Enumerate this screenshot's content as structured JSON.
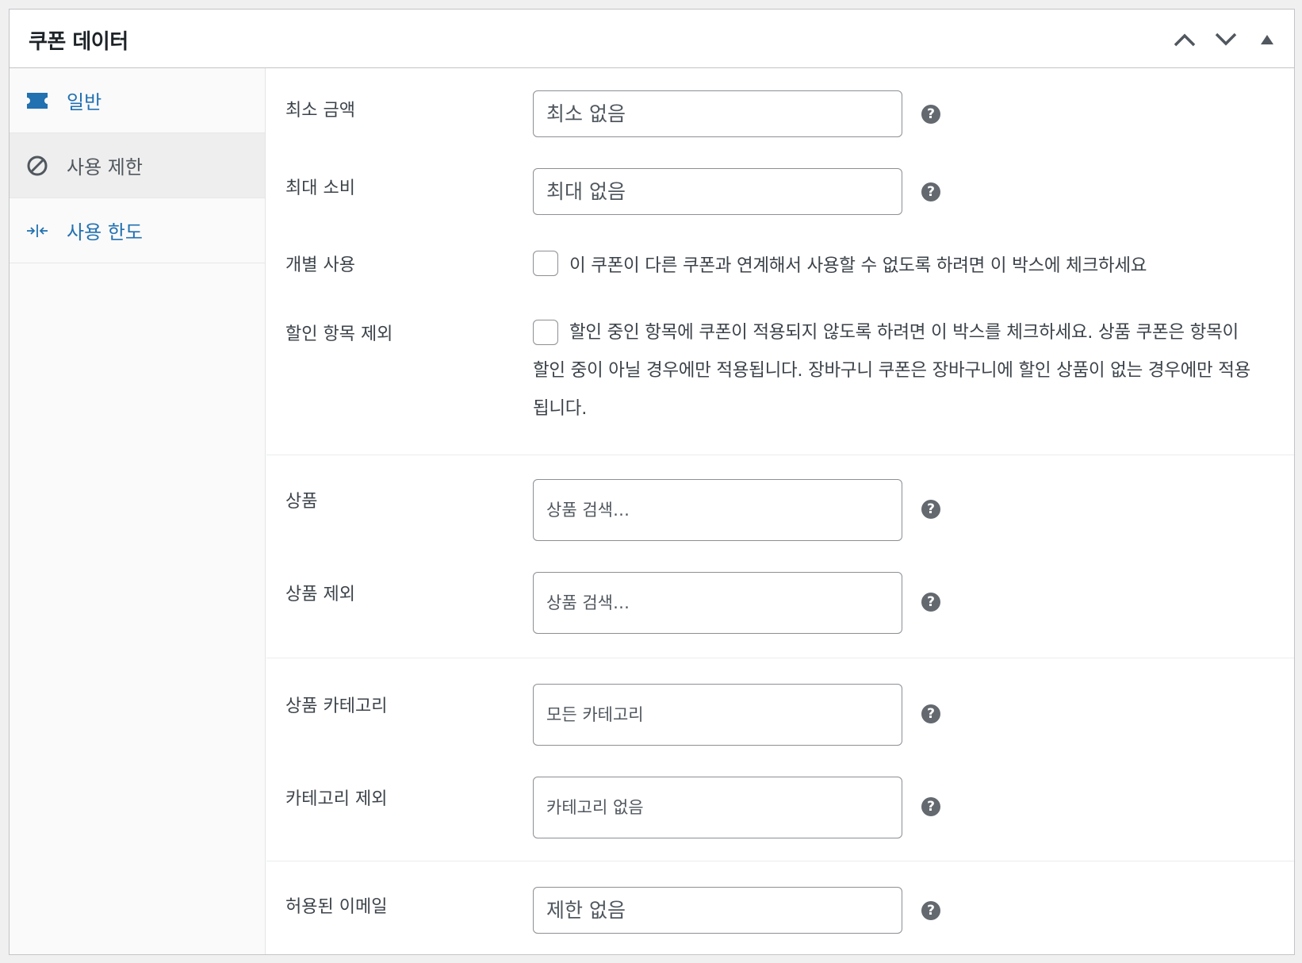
{
  "header": {
    "title": "쿠폰 데이터"
  },
  "tabs": [
    {
      "label": "일반",
      "icon": "ticket-icon",
      "active": false
    },
    {
      "label": "사용 제한",
      "icon": "ban-icon",
      "active": true
    },
    {
      "label": "사용 한도",
      "icon": "collapse-arrows-icon",
      "active": false
    }
  ],
  "fields": {
    "minimum_amount": {
      "label": "최소 금액",
      "placeholder": "최소 없음"
    },
    "maximum_amount": {
      "label": "최대 소비",
      "placeholder": "최대 없음"
    },
    "individual_use": {
      "label": "개별 사용",
      "description": "이 쿠폰이 다른 쿠폰과 연계해서 사용할 수 없도록 하려면 이 박스에 체크하세요",
      "checked": false
    },
    "exclude_sale_items": {
      "label": "할인 항목 제외",
      "description": "할인 중인 항목에 쿠폰이 적용되지 않도록 하려면 이 박스를 체크하세요. 상품 쿠폰은 항목이 할인 중이 아닐 경우에만 적용됩니다. 장바구니 쿠폰은 장바구니에 할인 상품이 없는 경우에만 적용됩니다.",
      "checked": false
    },
    "products": {
      "label": "상품",
      "placeholder": "상품 검색…"
    },
    "exclude_products": {
      "label": "상품 제외",
      "placeholder": "상품 검색…"
    },
    "product_categories": {
      "label": "상품 카테고리",
      "placeholder": "모든 카테고리"
    },
    "exclude_categories": {
      "label": "카테고리 제외",
      "placeholder": "카테고리 없음"
    },
    "allowed_emails": {
      "label": "허용된 이메일",
      "placeholder": "제한 없음"
    }
  },
  "help_tip": "?",
  "colors": {
    "link": "#2271b1",
    "text": "#3c434a",
    "border": "#c3c4c7",
    "help_tip_bg": "#646970"
  }
}
